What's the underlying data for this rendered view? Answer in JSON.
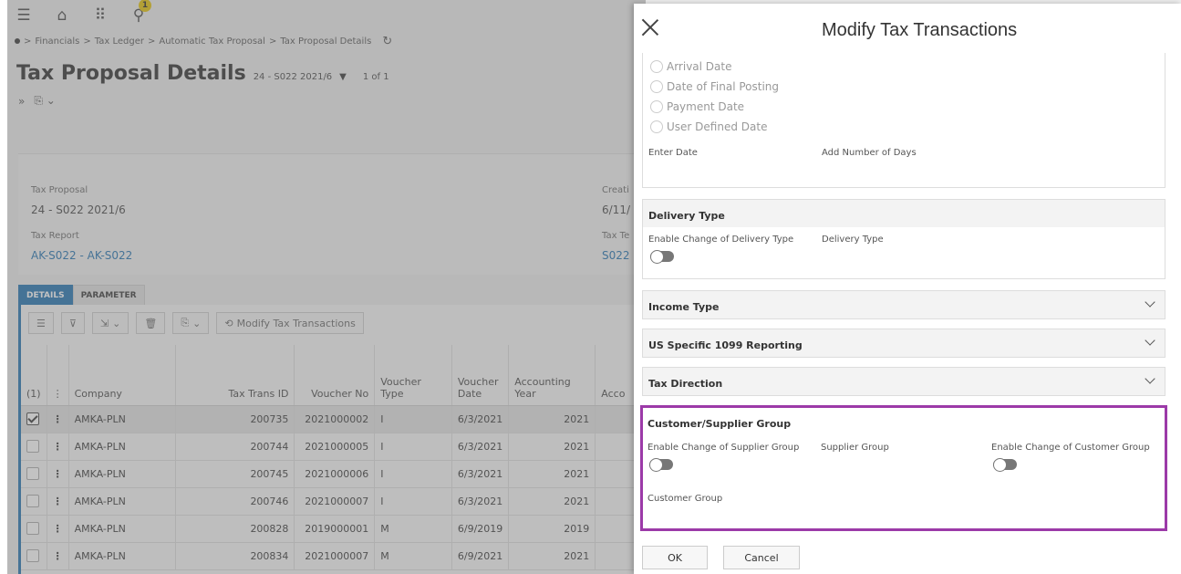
{
  "topbar": {
    "notification_count": "1"
  },
  "breadcrumb": {
    "items": [
      "Financials",
      "Tax Ledger",
      "Automatic Tax Proposal",
      "Tax Proposal Details"
    ],
    "separator": ">"
  },
  "page": {
    "title": "Tax Proposal Details",
    "record": "24 - S022 2021/6",
    "record_count": "1 of 1"
  },
  "header": {
    "tax_proposal_label": "Tax Proposal",
    "tax_proposal_value": "24 - S022 2021/6",
    "tax_report_label": "Tax Report",
    "tax_report_value": "AK-S022 - AK-S022",
    "creation_label": "Creati",
    "creation_value": "6/11/",
    "tax_te_label": "Tax Te",
    "tax_te_value": "S022"
  },
  "tabs": [
    {
      "label": "DETAILS",
      "active": true
    },
    {
      "label": "PARAMETER",
      "active": false
    }
  ],
  "grid": {
    "modify_button": "Modify Tax Transactions",
    "selected_count": "(1)",
    "columns": [
      "Company",
      "Tax Trans ID",
      "Voucher No",
      "Voucher Type",
      "Voucher Date",
      "Accounting Year",
      "Acco"
    ],
    "rows": [
      {
        "company": "AMKA-PLN",
        "tax_trans_id": "200735",
        "voucher_no": "2021000002",
        "voucher_type": "I",
        "voucher_date": "6/3/2021",
        "accounting_year": "2021",
        "selected": true
      },
      {
        "company": "AMKA-PLN",
        "tax_trans_id": "200744",
        "voucher_no": "2021000005",
        "voucher_type": "I",
        "voucher_date": "6/3/2021",
        "accounting_year": "2021",
        "selected": false
      },
      {
        "company": "AMKA-PLN",
        "tax_trans_id": "200745",
        "voucher_no": "2021000006",
        "voucher_type": "I",
        "voucher_date": "6/3/2021",
        "accounting_year": "2021",
        "selected": false
      },
      {
        "company": "AMKA-PLN",
        "tax_trans_id": "200746",
        "voucher_no": "2021000007",
        "voucher_type": "I",
        "voucher_date": "6/3/2021",
        "accounting_year": "2021",
        "selected": false
      },
      {
        "company": "AMKA-PLN",
        "tax_trans_id": "200828",
        "voucher_no": "2019000001",
        "voucher_type": "M",
        "voucher_date": "6/9/2019",
        "accounting_year": "2019",
        "selected": false
      },
      {
        "company": "AMKA-PLN",
        "tax_trans_id": "200834",
        "voucher_no": "2021000007",
        "voucher_type": "M",
        "voucher_date": "6/9/2021",
        "accounting_year": "2021",
        "selected": false
      }
    ]
  },
  "panel": {
    "title": "Modify Tax Transactions",
    "date_options": [
      "Arrival Date",
      "Date of Final Posting",
      "Payment Date",
      "User Defined Date"
    ],
    "enter_date_label": "Enter Date",
    "add_days_label": "Add Number of Days",
    "delivery": {
      "title": "Delivery Type",
      "enable_label": "Enable Change of Delivery Type",
      "field_label": "Delivery Type"
    },
    "income_type": "Income Type",
    "us_1099": "US Specific 1099 Reporting",
    "tax_direction": "Tax Direction",
    "group": {
      "title": "Customer/Supplier Group",
      "enable_supplier_label": "Enable Change of Supplier Group",
      "supplier_label": "Supplier Group",
      "enable_customer_label": "Enable Change of Customer Group",
      "customer_label": "Customer Group"
    },
    "ok_label": "OK",
    "cancel_label": "Cancel"
  },
  "colors": {
    "accent": "#1d6fb0",
    "highlight": "#9c3aa8"
  }
}
